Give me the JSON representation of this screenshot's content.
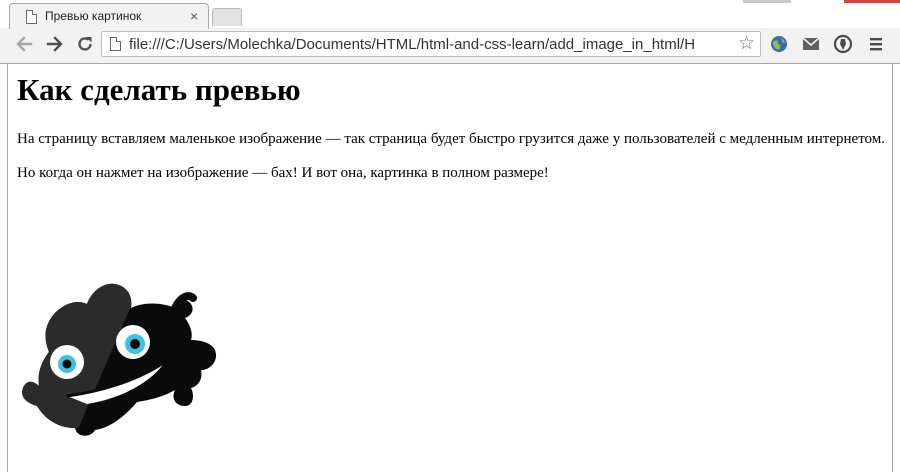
{
  "browser": {
    "tab_title": "Превью картинок",
    "tab_close": "×",
    "url": "file:///C:/Users/Molechka/Documents/HTML/html-and-css-learn/add_image_in_html/H",
    "star": "☆",
    "icons": {
      "back": "back-arrow-icon",
      "forward": "forward-arrow-icon",
      "reload": "reload-icon",
      "page": "page-icon",
      "star": "star-icon",
      "globe": "globe-icon",
      "mail": "mail-icon",
      "shield": "shield-icon",
      "menu": "menu-icon"
    }
  },
  "page": {
    "heading": "Как сделать превью",
    "paragraph1": "На страницу вставляем маленькое изображение — так страница будет быстро грузится даже у пользователей с медленным интернетом.",
    "paragraph2": "Но когда он нажмет на изображение — бах! И вот она, картинка в полном размере!",
    "image": {
      "name": "monster-mascot-image",
      "colors": {
        "body": "#0a0a0a",
        "body_light": "#2b2b2b",
        "eye_white": "#ffffff",
        "iris": "#3ec2df",
        "pupil": "#0a0a0a"
      }
    }
  }
}
